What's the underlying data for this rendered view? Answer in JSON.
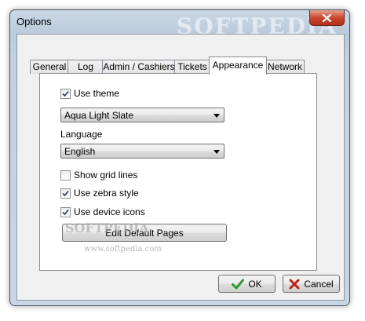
{
  "window": {
    "title": "Options",
    "watermark": "SOFTPEDIA"
  },
  "tabs": [
    {
      "label": "General"
    },
    {
      "label": "Log"
    },
    {
      "label": "Admin / Cashiers"
    },
    {
      "label": "Tickets"
    },
    {
      "label": "Appearance",
      "active": true
    },
    {
      "label": "Network"
    }
  ],
  "appearance": {
    "use_theme_label": "Use theme",
    "use_theme_checked": true,
    "theme_value": "Aqua Light Slate",
    "language_label": "Language",
    "language_value": "English",
    "show_grid_label": "Show grid lines",
    "show_grid_checked": false,
    "zebra_label": "Use zebra style",
    "zebra_checked": true,
    "device_icons_label": "Use device icons",
    "device_icons_checked": true,
    "edit_pages_label": "Edit Default Pages",
    "button_watermark": "SOFTPEDIA",
    "site_watermark": "www.softpedia.com"
  },
  "footer": {
    "ok_label": "OK",
    "cancel_label": "Cancel"
  },
  "colors": {
    "ok_icon": "#2f9a2f",
    "cancel_icon": "#c0201a",
    "close_button": "#c7432b"
  }
}
